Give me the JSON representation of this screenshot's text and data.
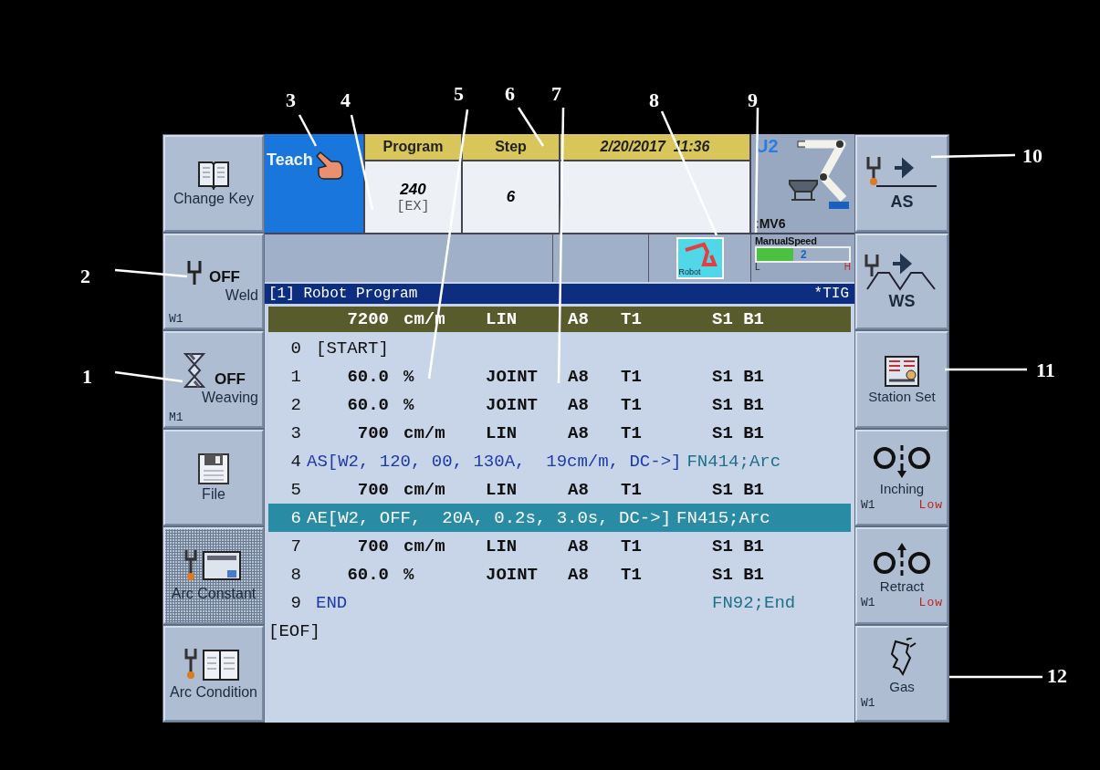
{
  "left_buttons": [
    {
      "kind": "book",
      "label": "Change Key",
      "pressed": false
    },
    {
      "kind": "weld",
      "label": "Weld",
      "status": "OFF",
      "channel": "W1",
      "pressed": false
    },
    {
      "kind": "weave",
      "label": "Weaving",
      "status": "OFF",
      "channel": "M1",
      "pressed": false
    },
    {
      "kind": "file",
      "label": "File",
      "pressed": false
    },
    {
      "kind": "arc-constant",
      "label": "Arc Constant",
      "pressed": true
    },
    {
      "kind": "arc-condition",
      "label": "Arc Condition",
      "pressed": false
    }
  ],
  "mode": {
    "label": "Teach"
  },
  "program": {
    "header": "Program",
    "value": "240",
    "sub": "[EX]"
  },
  "step": {
    "header": "Step",
    "value": "6"
  },
  "datetime": {
    "date": "2/20/2017",
    "time": "11:36"
  },
  "robot": {
    "unit": "U2",
    "model": ":MV6"
  },
  "robot_tile": {
    "label": "Robot"
  },
  "manual_speed": {
    "title": "ManualSpeed",
    "level": 0.4,
    "reading": "2",
    "low": "L",
    "high": "H"
  },
  "title_bar": {
    "title": "[1] Robot Program",
    "process": "*TIG"
  },
  "current_line": {
    "speed": "7200",
    "unit": "cm/m",
    "interp": "LIN",
    "tool": "A8",
    "t": "T1",
    "sb": "S1 B1"
  },
  "lines": [
    {
      "no": "0",
      "kind": "start",
      "text": "[START]",
      "selected": false
    },
    {
      "no": "1",
      "kind": "move",
      "speed": "60.0",
      "unit": "%",
      "interp": "JOINT",
      "tool": "A8",
      "t": "T1",
      "sb": "S1 B1",
      "selected": false
    },
    {
      "no": "2",
      "kind": "move",
      "speed": "60.0",
      "unit": "%",
      "interp": "JOINT",
      "tool": "A8",
      "t": "T1",
      "sb": "S1 B1",
      "selected": false
    },
    {
      "no": "3",
      "kind": "move",
      "speed": "700",
      "unit": "cm/m",
      "interp": "LIN",
      "tool": "A8",
      "t": "T1",
      "sb": "S1 B1",
      "selected": false
    },
    {
      "no": "4",
      "kind": "command",
      "text": "AS[W2, 120, 00, 130A,  19cm/m, DC->]",
      "fn": "FN414;Arc",
      "selected": false
    },
    {
      "no": "5",
      "kind": "move",
      "speed": "700",
      "unit": "cm/m",
      "interp": "LIN",
      "tool": "A8",
      "t": "T1",
      "sb": "S1 B1",
      "selected": false
    },
    {
      "no": "6",
      "kind": "command",
      "text": "AE[W2, OFF,  20A, 0.2s, 3.0s, DC->]",
      "fn": "FN415;Arc",
      "selected": true
    },
    {
      "no": "7",
      "kind": "move",
      "speed": "700",
      "unit": "cm/m",
      "interp": "LIN",
      "tool": "A8",
      "t": "T1",
      "sb": "S1 B1",
      "selected": false
    },
    {
      "no": "8",
      "kind": "move",
      "speed": "60.0",
      "unit": "%",
      "interp": "JOINT",
      "tool": "A8",
      "t": "T1",
      "sb": "S1 B1",
      "selected": false
    },
    {
      "no": "9",
      "kind": "end",
      "text": "END",
      "fn": "FN92;End",
      "selected": false
    }
  ],
  "eof": "[EOF]",
  "right_buttons": [
    {
      "kind": "as",
      "label": "AS"
    },
    {
      "kind": "ws",
      "label": "WS"
    },
    {
      "kind": "station",
      "label": "Station Set"
    },
    {
      "kind": "inching",
      "label": "Inching",
      "channel": "W1",
      "speed": "Low"
    },
    {
      "kind": "retract",
      "label": "Retract",
      "channel": "W1",
      "speed": "Low"
    },
    {
      "kind": "gas",
      "label": "Gas",
      "channel": "W1"
    }
  ],
  "callouts": [
    "3",
    "4",
    "5",
    "6",
    "7",
    "8",
    "9",
    "10",
    "11",
    "12",
    "2",
    "1"
  ]
}
